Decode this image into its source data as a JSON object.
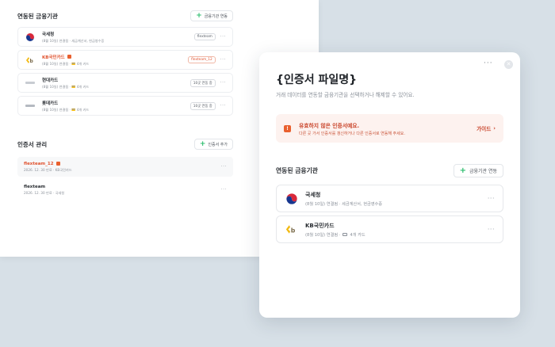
{
  "background": {
    "linked_section": {
      "title": "연동된 금융기관",
      "add_button": "금융기관 연동",
      "items": [
        {
          "name": "국세청",
          "sub": "(8월 10일) 연결됨 · 세금계산서, 현금영수증",
          "tag": "flexteam",
          "error": false
        },
        {
          "name": "KB국민카드",
          "sub": "(8월 10일) 연결됨 · 💳 4개 카드",
          "tag": "flexteam_12",
          "error": true
        },
        {
          "name": "현대카드",
          "sub": "(8월 10일) 연결됨 · 💳 4개 카드",
          "tag": "10곳 연동 중",
          "error": false
        },
        {
          "name": "롯데카드",
          "sub": "(8월 10일) 연결됨 · 💳 4개 카드",
          "tag": "10곳 연동 중",
          "error": false
        }
      ]
    },
    "cert_section": {
      "title": "인증서 관리",
      "add_button": "인증서 추가",
      "items": [
        {
          "name": "flexteam_12",
          "sub": "2026. 12. 30 만료 · KB국민카드",
          "error": true
        },
        {
          "name": "flexteam",
          "sub": "2026. 12. 30 만료 · 국세청",
          "error": false
        }
      ]
    }
  },
  "modal": {
    "title": "{인증서 파일명}",
    "description": "거래 데이터를 연동할 금융기관을 선택하거나 해제할 수 있어요.",
    "alert": {
      "title": "유효하지 않은 인증서예요.",
      "sub": "다른 곳 가서 인증서를 갱신하거나 다른 인증서로 연동해 주세요.",
      "link": "가이드"
    },
    "section_title": "연동된 금융기관",
    "add_button": "금융기관 연동",
    "items": [
      {
        "name": "국세청",
        "sub": "(8월 10일) 연결됨 · 세금계산서, 현금영수증",
        "has_card_icon": false
      },
      {
        "name": "KB국민카드",
        "sub": "(8월 10일) 연결됨 ·",
        "cards": "4개 카드",
        "has_card_icon": true
      }
    ]
  },
  "colors": {
    "accent_green": "#2dbd6e",
    "error": "#e9602e",
    "kb_yellow": "#f2b90f"
  }
}
